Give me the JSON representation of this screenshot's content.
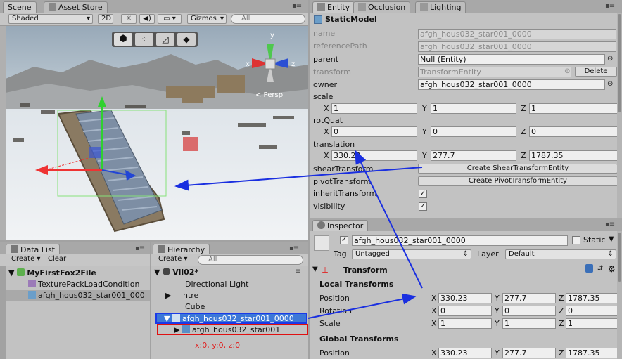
{
  "scene": {
    "tabs": [
      "Scene",
      "Asset Store"
    ],
    "toolbar": {
      "shading": "Shaded",
      "mode_2d": "2D",
      "gizmos": "Gizmos",
      "search_placeholder": "All"
    },
    "persp_label": "< Persp",
    "axis_y": "y",
    "axis_z": "z",
    "handle_tools": [
      "hex",
      "nodes",
      "vertex",
      "face"
    ]
  },
  "entity": {
    "tabs": [
      "Entity",
      "Occlusion",
      "Lighting"
    ],
    "title": "StaticModel",
    "fields": {
      "name_label": "name",
      "name_value": "afgh_hous032_star001_0000",
      "refpath_label": "referencePath",
      "refpath_value": "afgh_hous032_star001_0000",
      "parent_label": "parent",
      "parent_value": "Null (Entity)",
      "transform_label": "transform",
      "transform_value": "TransformEntity",
      "delete_label": "Delete",
      "owner_label": "owner",
      "owner_value": "afgh_hous032_star001_0000",
      "scale_label": "scale",
      "scale_x": "1",
      "scale_y": "1",
      "scale_z": "1",
      "rotquat_label": "rotQuat",
      "rotquat_x": "0",
      "rotquat_y": "0",
      "rotquat_z": "0",
      "translation_label": "translation",
      "trans_x": "330.23",
      "trans_y": "277.7",
      "trans_z": "1787.35",
      "shear_label": "shearTransform",
      "shear_btn": "Create ShearTransformEntity",
      "pivot_label": "pivotTransform",
      "pivot_btn": "Create PivotTransformEntity",
      "inherit_label": "inheritTransform",
      "visibility_label": "visibility",
      "axis_x": "X",
      "axis_y": "Y",
      "axis_z": "Z"
    }
  },
  "datalist": {
    "tab": "Data List",
    "create": "Create",
    "clear": "Clear",
    "items": [
      "MyFirstFox2File",
      "TexturePackLoadCondition",
      "afgh_hous032_star001_000"
    ]
  },
  "hierarchy": {
    "tab": "Hierarchy",
    "create": "Create",
    "search_placeholder": "All",
    "scene_name": "Vil02*",
    "items": [
      "Directional Light",
      "htre",
      "Cube",
      "afgh_hous032_star001_0000",
      "afgh_hous032_star001"
    ],
    "coords_note": "x:0, y:0, z:0"
  },
  "inspector": {
    "tab": "Inspector",
    "object_name": "afgh_hous032_star001_0000",
    "static_label": "Static",
    "tag_label": "Tag",
    "tag_value": "Untagged",
    "layer_label": "Layer",
    "layer_value": "Default",
    "component": "Transform",
    "local_header": "Local Transforms",
    "global_header": "Global Transforms",
    "position_label": "Position",
    "rotation_label": "Rotation",
    "scale_label": "Scale",
    "pos": [
      "330.23",
      "277.7",
      "1787.35"
    ],
    "rot": [
      "0",
      "0",
      "0"
    ],
    "scl": [
      "1",
      "1",
      "1"
    ],
    "gpos": [
      "330.23",
      "277.7",
      "1787.35"
    ],
    "axis_x": "X",
    "axis_y": "Y",
    "axis_z": "Z"
  },
  "annotation_colors": {
    "arrow": "#1a2fe0",
    "highlight_blue": "#1a3ae8",
    "highlight_red": "#e01010",
    "note_red": "#e02020"
  }
}
